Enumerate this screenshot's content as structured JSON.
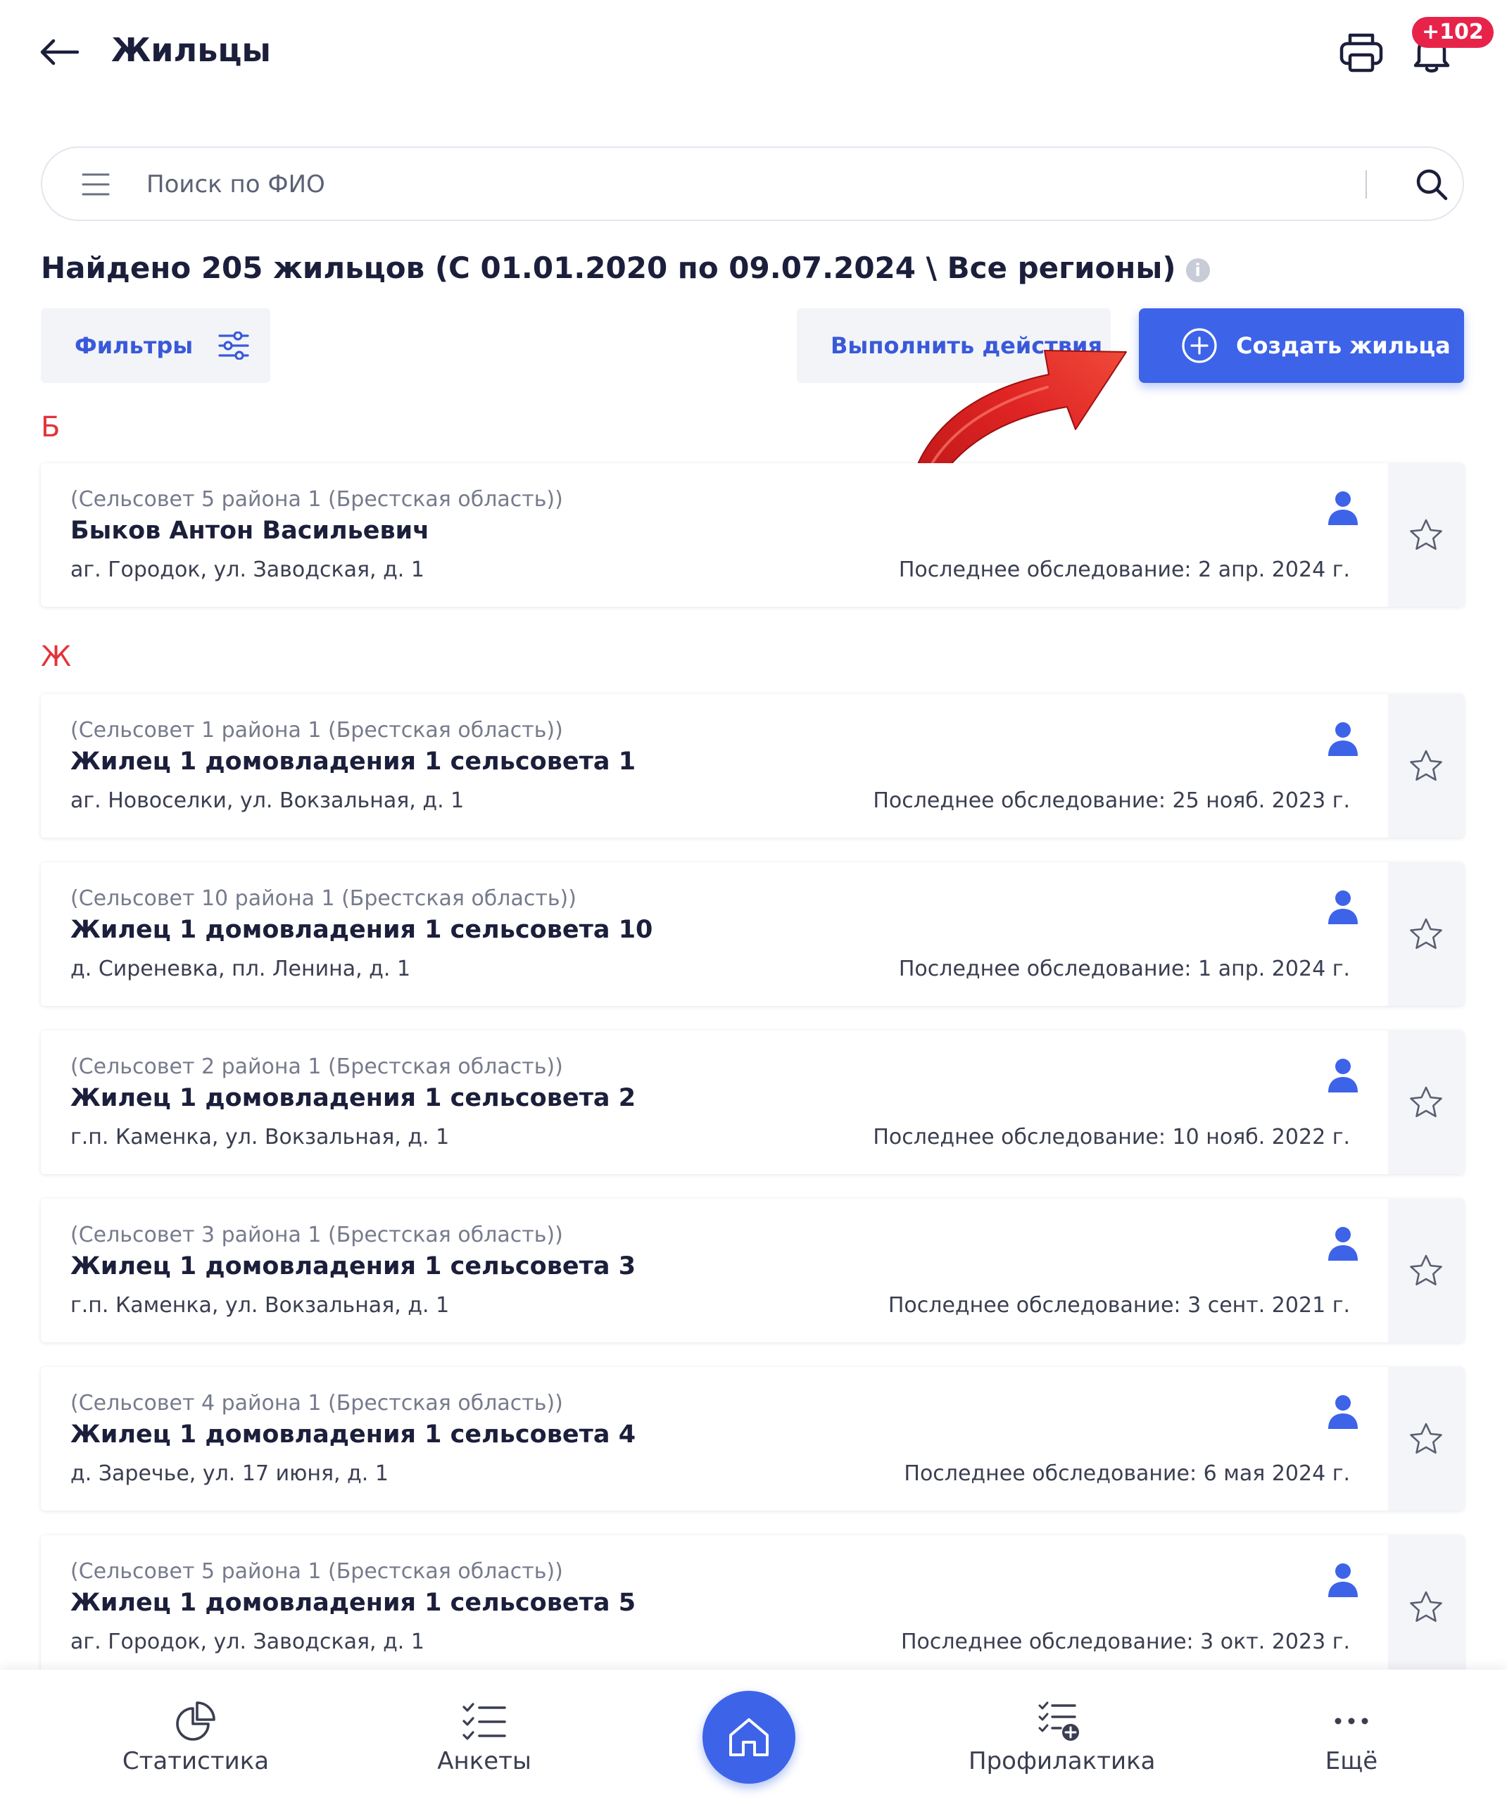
{
  "header": {
    "title": "Жильцы",
    "back_icon": "arrow-left-icon",
    "print_icon": "printer-icon",
    "bell_icon": "bell-icon",
    "notification_badge": "+102"
  },
  "search": {
    "placeholder": "Поиск по ФИО",
    "value": ""
  },
  "summary": {
    "found_text": "Найдено 205 жильцов (С 01.01.2020 по 09.07.2024 \\ Все регионы)",
    "info_icon": "i"
  },
  "toolbar": {
    "filters_label": "Фильтры",
    "actions_label": "Выполнить действия",
    "create_label": "Создать жильца"
  },
  "groups": [
    {
      "letter": "Б",
      "residents": [
        {
          "council": "(Сельсовет 5 района 1 (Брестская область))",
          "name": "Быков Антон Васильевич",
          "address": "аг. Городок, ул. Заводская, д. 1",
          "last_exam": "Последнее обследование: 2 апр. 2024 г."
        }
      ]
    },
    {
      "letter": "Ж",
      "residents": [
        {
          "council": "(Сельсовет 1 района 1 (Брестская область))",
          "name": "Жилец 1 домовладения 1 сельсовета 1",
          "address": "аг. Новоселки, ул. Вокзальная, д. 1",
          "last_exam": "Последнее обследование: 25 нояб. 2023 г."
        },
        {
          "council": "(Сельсовет 10 района 1 (Брестская область))",
          "name": "Жилец 1 домовладения 1 сельсовета 10",
          "address": "д. Сиреневка, пл. Ленина, д. 1",
          "last_exam": "Последнее обследование: 1 апр. 2024 г."
        },
        {
          "council": "(Сельсовет 2 района 1 (Брестская область))",
          "name": "Жилец 1 домовладения 1 сельсовета 2",
          "address": "г.п. Каменка, ул. Вокзальная, д. 1",
          "last_exam": "Последнее обследование: 10 нояб. 2022 г."
        },
        {
          "council": "(Сельсовет 3 района 1 (Брестская область))",
          "name": "Жилец 1 домовладения 1 сельсовета 3",
          "address": "г.п. Каменка, ул. Вокзальная, д. 1",
          "last_exam": "Последнее обследование: 3 сент. 2021 г."
        },
        {
          "council": "(Сельсовет 4 района 1 (Брестская область))",
          "name": "Жилец 1 домовладения 1 сельсовета 4",
          "address": "д. Заречье, ул. 17 июня, д. 1",
          "last_exam": "Последнее обследование: 6 мая 2024 г."
        },
        {
          "council": "(Сельсовет 5 района 1 (Брестская область))",
          "name": "Жилец 1 домовладения 1 сельсовета 5",
          "address": "аг. Городок, ул. Заводская, д. 1",
          "last_exam": "Последнее обследование: 3 окт. 2023 г."
        }
      ]
    }
  ],
  "bottom_nav": {
    "statistics": "Статистика",
    "forms": "Анкеты",
    "home_icon": "home-icon",
    "prevention": "Профилактика",
    "more": "Ещё"
  },
  "colors": {
    "accent": "#3d63e8",
    "letter": "#e3333b",
    "badge": "#e8234a",
    "annotation_arrow": "#d81e1e"
  }
}
